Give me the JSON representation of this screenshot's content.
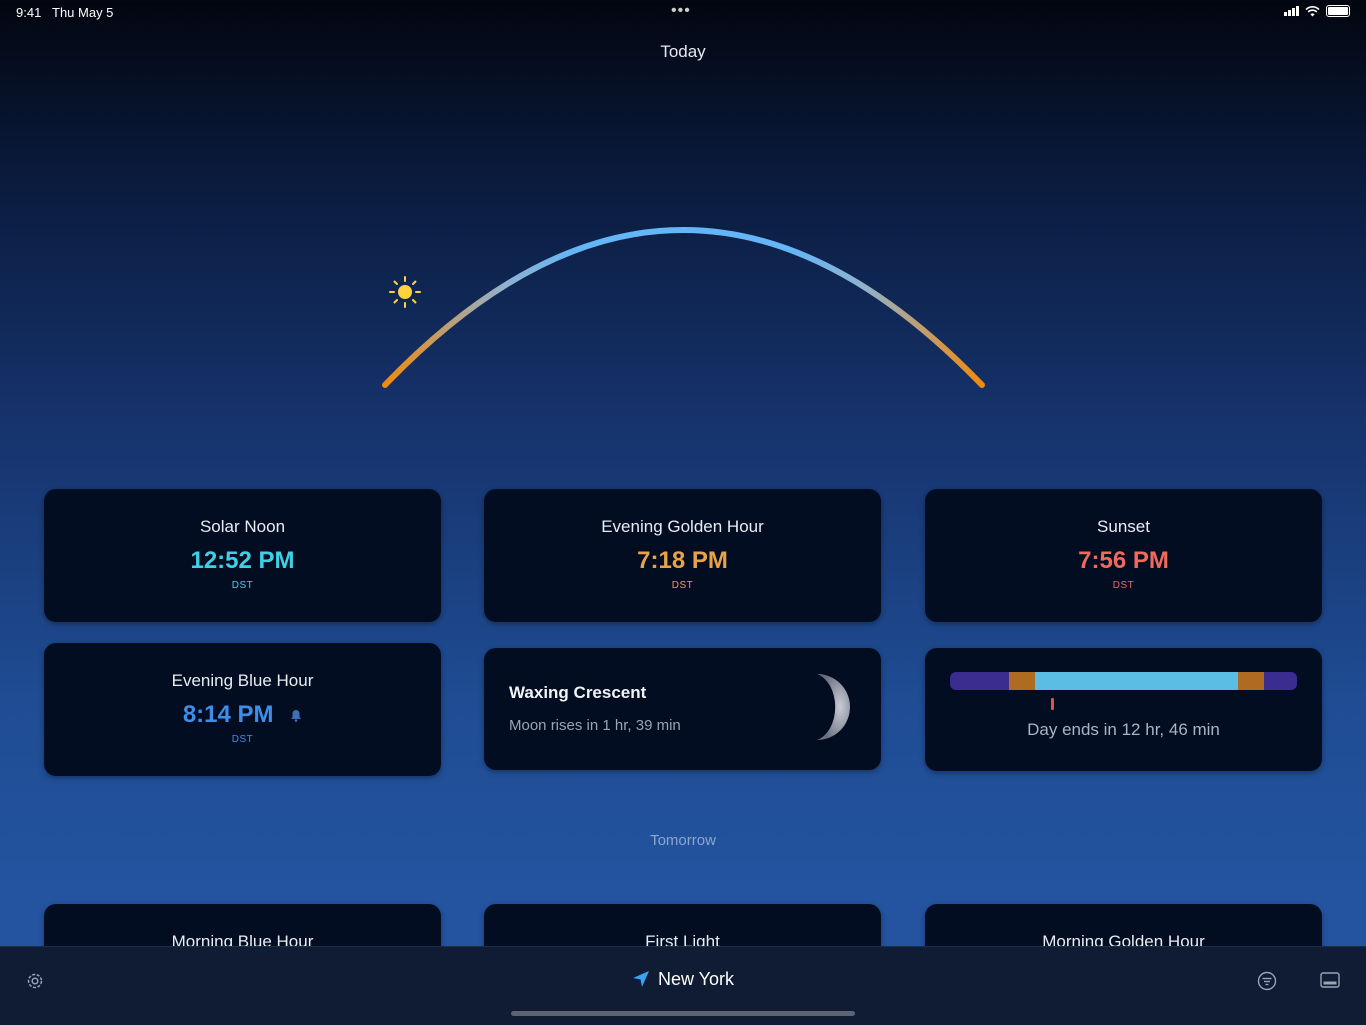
{
  "status": {
    "time": "9:41",
    "date": "Thu May 5",
    "dots": "•••"
  },
  "header": {
    "title": "Today"
  },
  "today_cards": [
    {
      "title": "Solar Noon",
      "time": "12:52 PM",
      "zone": "DST",
      "color": "#3ed1e6"
    },
    {
      "title": "Evening Golden Hour",
      "time": "7:18 PM",
      "zone": "DST",
      "color": "#e8a247"
    },
    {
      "title": "Sunset",
      "time": "7:56 PM",
      "zone": "DST",
      "color": "#f0695c"
    },
    {
      "title": "Evening Blue Hour",
      "time": "8:14 PM",
      "zone": "DST",
      "color": "#3d8eeb"
    }
  ],
  "moon": {
    "phase": "Waxing Crescent",
    "subtitle": "Moon rises in 1 hr, 39 min"
  },
  "day": {
    "label": "Day ends in 12 hr, 46 min",
    "segments": [
      {
        "color": "#3a2d8f",
        "fraction": 0.17
      },
      {
        "color": "#b06b22",
        "fraction": 0.075
      },
      {
        "color": "#5bbde3",
        "fraction": 0.585
      },
      {
        "color": "#b06b22",
        "fraction": 0.075
      },
      {
        "color": "#3a2d8f",
        "fraction": 0.095
      }
    ]
  },
  "tomorrow": {
    "label": "Tomorrow",
    "cards": [
      {
        "title": "Morning Blue Hour"
      },
      {
        "title": "First Light"
      },
      {
        "title": "Morning Golden Hour"
      }
    ]
  },
  "bottom": {
    "location": "New York"
  },
  "icons": {
    "sun": "sun-icon",
    "bell": "bell-icon",
    "settings": "gear-icon",
    "location": "location-arrow-icon",
    "filter": "filter-icon",
    "layout": "sidebar-icon"
  }
}
